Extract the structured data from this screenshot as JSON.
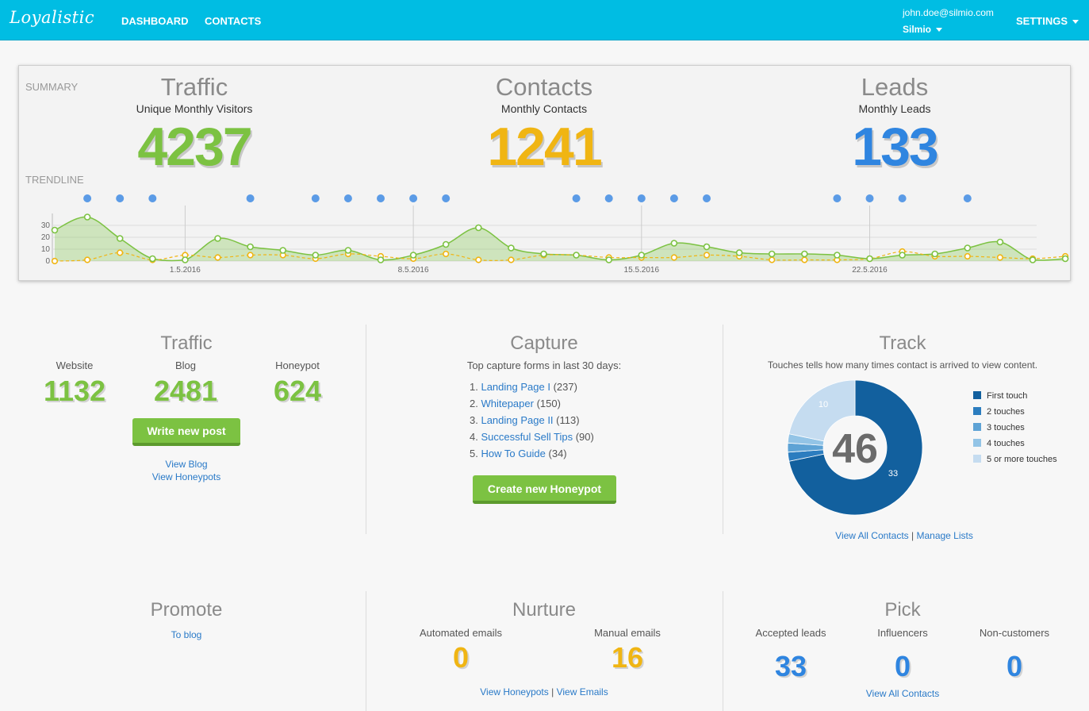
{
  "app": {
    "logo": "Loyalistic"
  },
  "nav": {
    "dashboard": "DASHBOARD",
    "contacts": "CONTACTS",
    "settings": "SETTINGS"
  },
  "user": {
    "email": "john.doe@silmio.com",
    "org": "Silmio"
  },
  "summary": {
    "label": "SUMMARY",
    "trendline_label": "TRENDLINE",
    "traffic": {
      "title": "Traffic",
      "subtitle": "Unique Monthly Visitors",
      "value": "4237"
    },
    "contacts": {
      "title": "Contacts",
      "subtitle": "Monthly Contacts",
      "value": "1241"
    },
    "leads": {
      "title": "Leads",
      "subtitle": "Monthly Leads",
      "value": "133"
    }
  },
  "chart_data": {
    "type": "area",
    "x": [
      "27.4.2016",
      "28.4.2016",
      "29.4.2016",
      "30.4.2016",
      "1.5.2016",
      "2.5.2016",
      "3.5.2016",
      "4.5.2016",
      "5.5.2016",
      "6.5.2016",
      "7.5.2016",
      "8.5.2016",
      "9.5.2016",
      "10.5.2016",
      "11.5.2016",
      "12.5.2016",
      "13.5.2016",
      "14.5.2016",
      "15.5.2016",
      "16.5.2016",
      "17.5.2016",
      "18.5.2016",
      "19.5.2016",
      "20.5.2016",
      "21.5.2016",
      "22.5.2016",
      "23.5.2016",
      "24.5.2016",
      "25.5.2016",
      "26.5.2016"
    ],
    "x_tick_labels": [
      "1.5.2016",
      "8.5.2016",
      "15.5.2016",
      "22.5.2016"
    ],
    "series": [
      {
        "values": [
          26,
          37,
          19,
          2,
          1,
          19,
          12,
          9,
          5,
          9,
          1,
          5,
          14,
          28,
          11,
          6,
          5,
          1,
          5,
          15,
          12,
          7,
          6,
          6,
          5,
          2,
          5,
          6,
          11,
          16,
          1,
          2
        ]
      },
      {
        "values": [
          0,
          1,
          7,
          1,
          5,
          3,
          5,
          5,
          2,
          6,
          4,
          2,
          6,
          1,
          1,
          5,
          5,
          3,
          3,
          3,
          5,
          4,
          1,
          1,
          1,
          2,
          8,
          4,
          4,
          3,
          2,
          4
        ]
      }
    ],
    "event_markers": [
      1,
      2,
      3,
      6,
      8,
      9,
      10,
      11,
      12,
      16,
      17,
      18,
      19,
      20,
      24,
      25,
      26,
      28
    ],
    "y_ticks": [
      "0",
      "10",
      "20",
      "30"
    ],
    "ylim": [
      0,
      40
    ],
    "colors": {
      "series1": "#7cc242",
      "series2": "#f0b513",
      "markers": "#5b9be6"
    }
  },
  "traffic": {
    "title": "Traffic",
    "website_label": "Website",
    "website_value": "1132",
    "blog_label": "Blog",
    "blog_value": "2481",
    "honeypot_label": "Honeypot",
    "honeypot_value": "624",
    "button": "Write new post",
    "link_blog": "View Blog",
    "link_honeypots": "View Honeypots"
  },
  "capture": {
    "title": "Capture",
    "subtitle": "Top capture forms in last 30 days:",
    "items": [
      {
        "num": "1.",
        "name": "Landing Page I",
        "count": "(237)"
      },
      {
        "num": "2.",
        "name": "Whitepaper",
        "count": "(150)"
      },
      {
        "num": "3.",
        "name": "Landing Page II",
        "count": "(113)"
      },
      {
        "num": "4.",
        "name": "Successful Sell Tips",
        "count": "(90)"
      },
      {
        "num": "5.",
        "name": "How To Guide",
        "count": "(34)"
      }
    ],
    "button": "Create new Honeypot"
  },
  "track": {
    "title": "Track",
    "subtitle": "Touches tells how many times contact is arrived to view content.",
    "total": "46",
    "donut": [
      {
        "label": "First touch",
        "value": 33,
        "color": "#12609e"
      },
      {
        "label": "2 touches",
        "value": 1,
        "color": "#2c7dbf"
      },
      {
        "label": "3 touches",
        "value": 1,
        "color": "#5ea3d5"
      },
      {
        "label": "4 touches",
        "value": 1,
        "color": "#93c4e6"
      },
      {
        "label": "5 or more touches",
        "value": 10,
        "color": "#c5dcf0"
      }
    ],
    "label_first": "33",
    "label_five": "10",
    "link_contacts": "View All Contacts",
    "link_separator": "|",
    "link_lists": "Manage Lists"
  },
  "promote": {
    "title": "Promote",
    "link": "To blog"
  },
  "nurture": {
    "title": "Nurture",
    "auto_label": "Automated emails",
    "auto_value": "0",
    "manual_label": "Manual emails",
    "manual_value": "16",
    "link_honeypots": "View Honeypots",
    "link_separator": "|",
    "link_emails": "View Emails"
  },
  "pick": {
    "title": "Pick",
    "accepted_label": "Accepted leads",
    "accepted_value": "33",
    "influencers_label": "Influencers",
    "influencers_value": "0",
    "noncustomers_label": "Non-customers",
    "noncustomers_value": "0",
    "link": "View All Contacts"
  }
}
